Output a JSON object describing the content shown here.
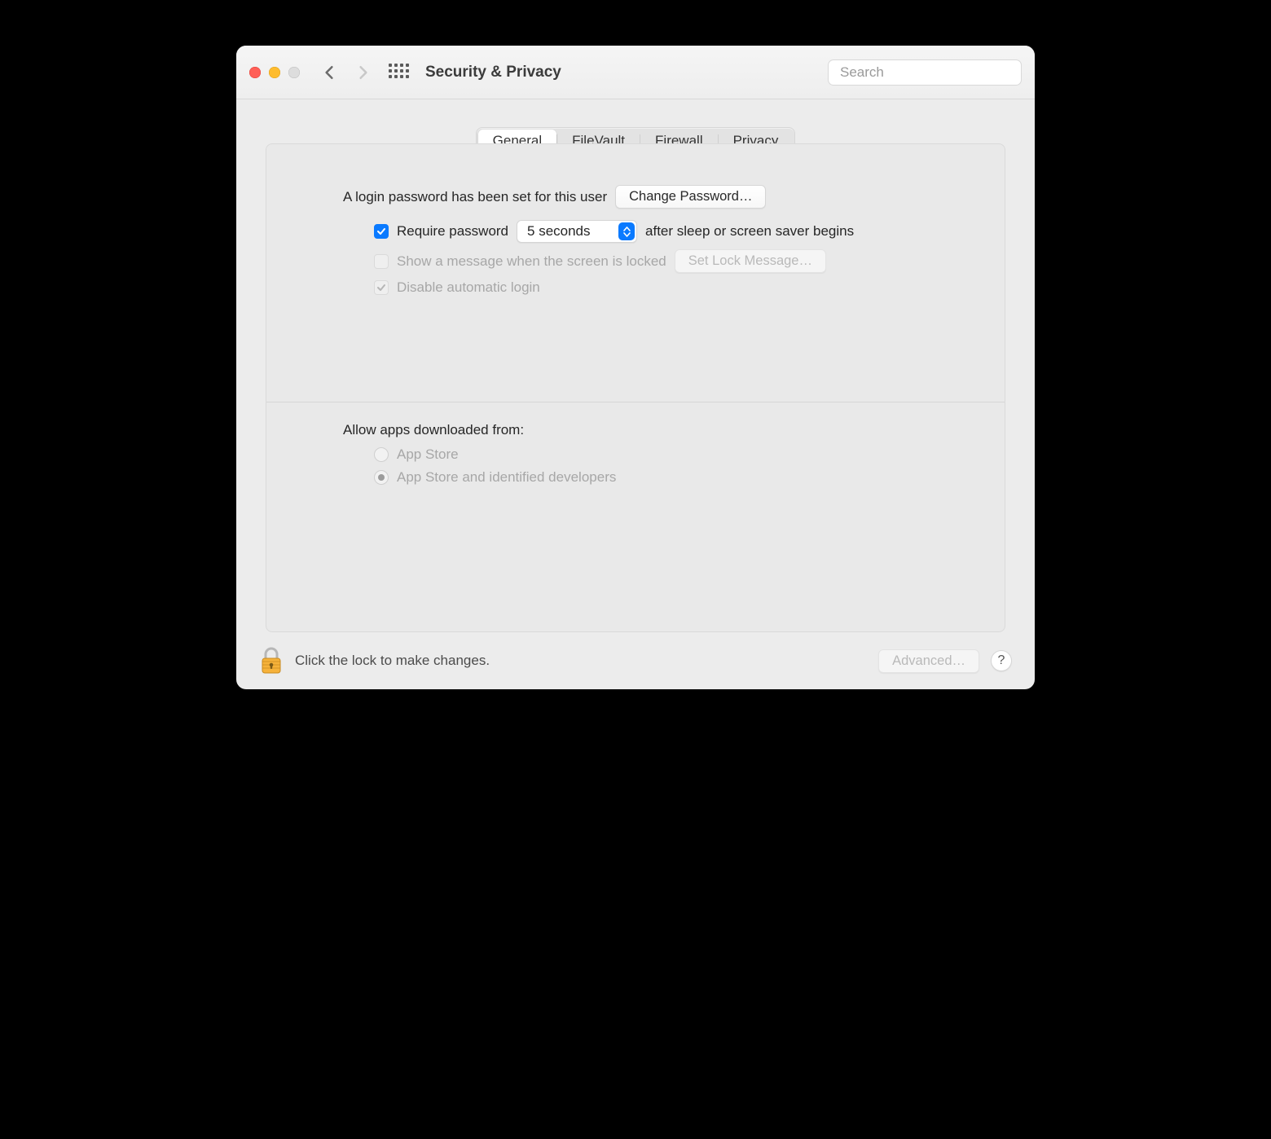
{
  "window": {
    "title": "Security & Privacy"
  },
  "search": {
    "placeholder": "Search"
  },
  "tabs": {
    "general": "General",
    "filevault": "FileVault",
    "firewall": "Firewall",
    "privacy": "Privacy",
    "active": "general"
  },
  "general": {
    "login_password_set": "A login password has been set for this user",
    "change_password": "Change Password…",
    "require_password": "Require password",
    "require_delay": "5 seconds",
    "after_sleep": "after sleep or screen saver begins",
    "show_lock_message": "Show a message when the screen is locked",
    "set_lock_message": "Set Lock Message…",
    "disable_auto_login": "Disable automatic login",
    "allow_apps_heading": "Allow apps downloaded from:",
    "opt_app_store": "App Store",
    "opt_app_store_dev": "App Store and identified developers"
  },
  "footer": {
    "lock_hint": "Click the lock to make changes.",
    "advanced": "Advanced…",
    "help": "?"
  }
}
